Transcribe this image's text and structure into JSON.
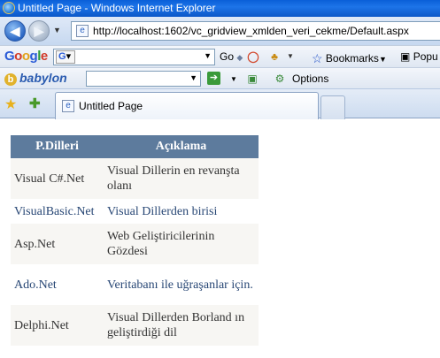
{
  "window": {
    "title": "Untitled Page - Windows Internet Explorer"
  },
  "address_bar": {
    "url": "http://localhost:1602/vc_gridview_xmlden_veri_cekme/Default.aspx"
  },
  "google_toolbar": {
    "logo": "Google",
    "go_label": "Go",
    "bookmarks_label": "Bookmarks",
    "popup_label": "Popu"
  },
  "babylon_toolbar": {
    "logo": "babylon",
    "options_label": "Options"
  },
  "tabs": [
    {
      "label": "Untitled Page"
    }
  ],
  "grid": {
    "header_color": "#5d7b9d",
    "columns": [
      "P.Dilleri",
      "Açıklama"
    ],
    "rows": [
      {
        "name": "Visual C#.Net",
        "desc": "Visual Dillerin en revanşta olanı"
      },
      {
        "name": "VisualBasic.Net",
        "desc": "Visual Dillerden birisi"
      },
      {
        "name": "Asp.Net",
        "desc": "Web Geliştiricilerinin Gözdesi"
      },
      {
        "name": "Ado.Net",
        "desc": "Veritabanı ile uğraşanlar için."
      },
      {
        "name": "Delphi.Net",
        "desc": "Visual Dillerden Borland ın geliştirdiği dil"
      }
    ]
  }
}
